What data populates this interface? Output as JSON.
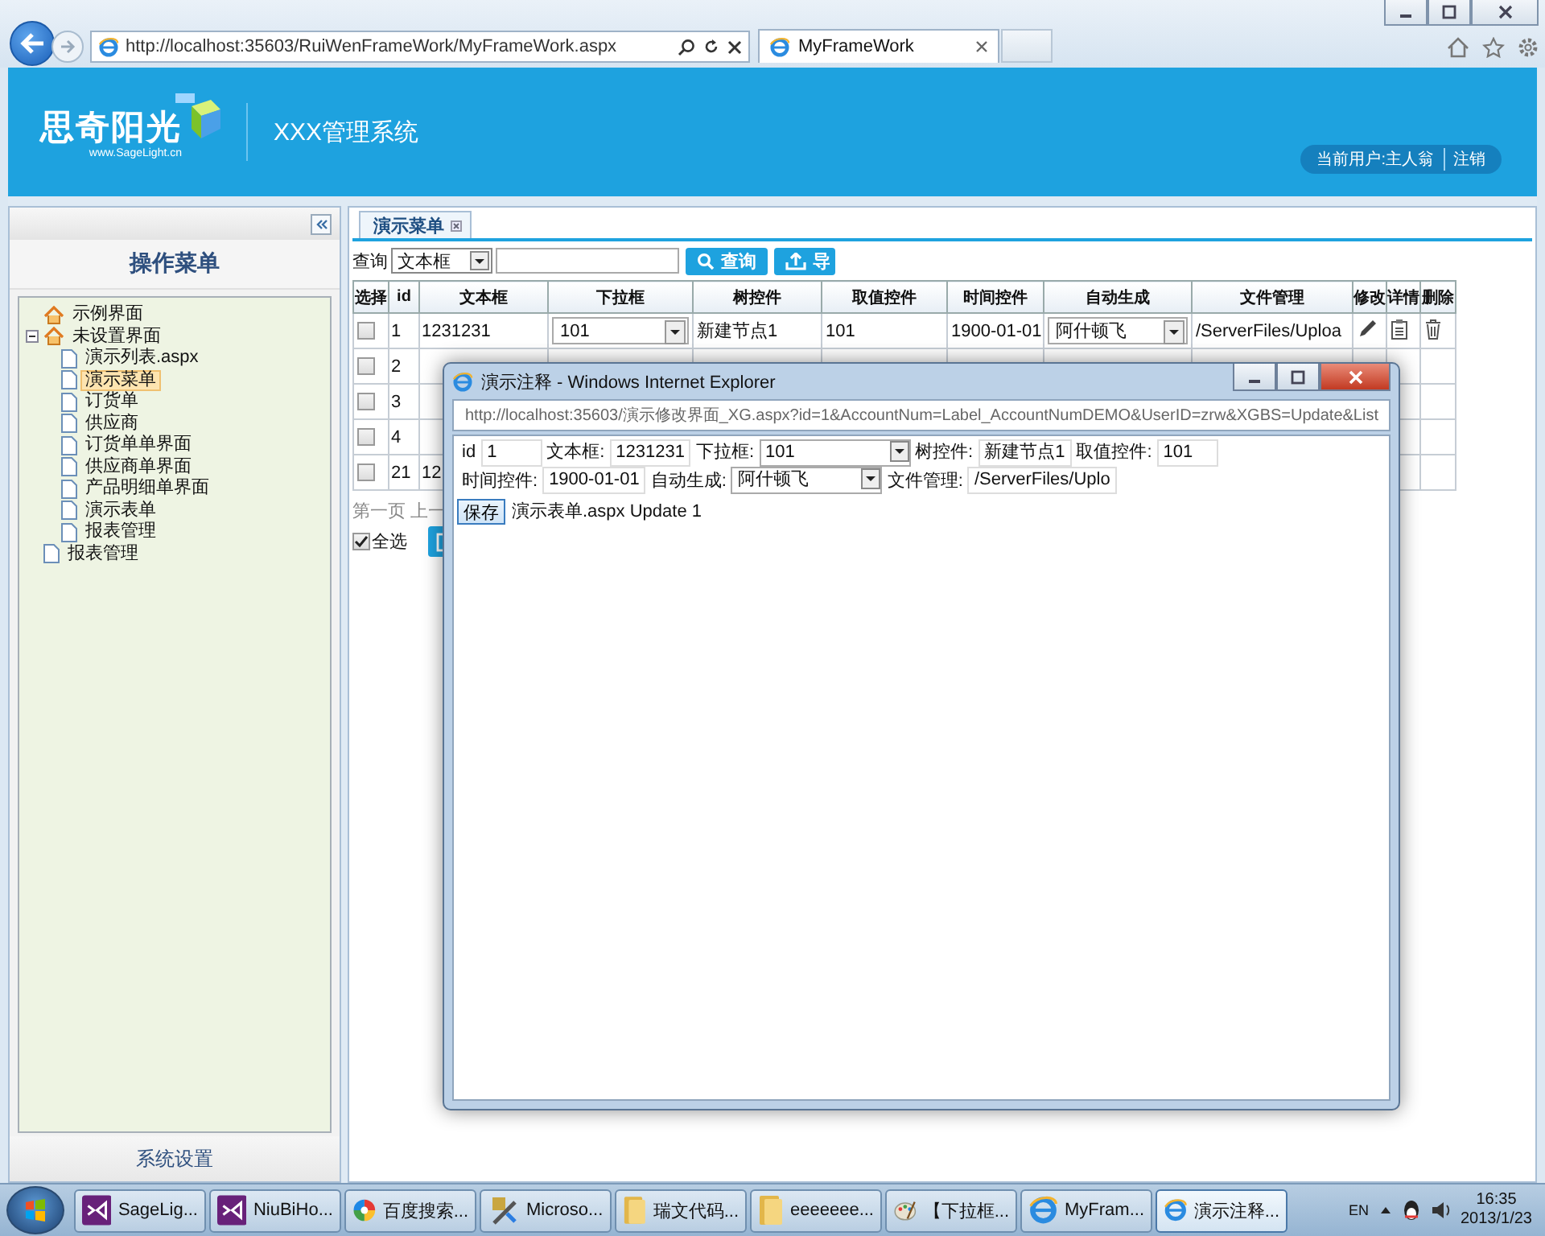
{
  "browser": {
    "address": "http://localhost:35603/RuiWenFrameWork/MyFrameWork.aspx",
    "tab": "MyFrameWork"
  },
  "header": {
    "logo": "思奇阳光",
    "logo_sub": "www.SageLight.cn",
    "system_title": "XXX管理系统",
    "user": "当前用户:主人翁",
    "logout": "注销"
  },
  "sidebar": {
    "title": "操作菜单",
    "footer": "系统设置",
    "tree": [
      {
        "label": "示例界面",
        "kind": "home",
        "selected": false
      },
      {
        "label": "未设置界面",
        "kind": "home",
        "selected": false,
        "expanded": true,
        "children": [
          {
            "label": "演示列表.aspx",
            "kind": "page",
            "selected": false
          },
          {
            "label": "演示菜单",
            "kind": "page",
            "selected": true
          },
          {
            "label": "订货单",
            "kind": "page",
            "selected": false
          },
          {
            "label": "供应商",
            "kind": "page",
            "selected": false
          },
          {
            "label": "订货单单界面",
            "kind": "page",
            "selected": false
          },
          {
            "label": "供应商单界面",
            "kind": "page",
            "selected": false
          },
          {
            "label": "产品明细单界面",
            "kind": "page",
            "selected": false
          },
          {
            "label": "演示表单",
            "kind": "page",
            "selected": false
          },
          {
            "label": "报表管理",
            "kind": "page",
            "selected": false
          }
        ]
      },
      {
        "label": "报表管理",
        "kind": "page",
        "selected": false
      }
    ]
  },
  "main": {
    "tab": "演示菜单",
    "query": {
      "label": "查询",
      "field": "文本框",
      "search_button": "查询",
      "export_button": "导"
    },
    "table": {
      "columns": [
        "选择",
        "id",
        "文本框",
        "下拉框",
        "树控件",
        "取值控件",
        "时间控件",
        "自动生成",
        "文件管理",
        "修改",
        "详情",
        "删除"
      ],
      "rows": [
        {
          "checked": false,
          "id": "1",
          "text": "1231231",
          "dropdown": "101",
          "tree": "新建节点1",
          "value": "101",
          "date": "1900-01-01",
          "auto": "阿什顿飞",
          "file": "/ServerFiles/Uploa"
        },
        {
          "checked": false,
          "id": "2"
        },
        {
          "checked": false,
          "id": "3"
        },
        {
          "checked": false,
          "id": "4"
        },
        {
          "checked": false,
          "id": "21",
          "text": "12"
        }
      ]
    },
    "pager": "第一页 上一",
    "select_all": {
      "label": "全选",
      "checked": true
    }
  },
  "popup": {
    "title": "演示注释 - Windows Internet Explorer",
    "address": "http://localhost:35603/演示修改界面_XG.aspx?id=1&AccountNum=Label_AccountNumDEMO&UserID=zrw&XGBS=Update&List",
    "fields": [
      {
        "label": "id",
        "value": "1",
        "kind": "input"
      },
      {
        "label": "文本框:",
        "value": "1231231",
        "kind": "input"
      },
      {
        "label": "下拉框:",
        "value": "101",
        "kind": "select"
      },
      {
        "label": "树控件:",
        "value": "新建节点1",
        "kind": "input"
      },
      {
        "label": "取值控件:",
        "value": "101",
        "kind": "input"
      },
      {
        "label": "时间控件:",
        "value": "1900-01-01",
        "kind": "input"
      },
      {
        "label": "自动生成:",
        "value": "阿什顿飞",
        "kind": "select"
      },
      {
        "label": "文件管理:",
        "value": "/ServerFiles/Uplo",
        "kind": "input"
      }
    ],
    "save_button": "保存",
    "message": "演示表单.aspx Update 1"
  },
  "taskbar": {
    "items": [
      {
        "label": "SageLig...",
        "kind": "vs",
        "selected": false
      },
      {
        "label": "NiuBiHo...",
        "kind": "vs",
        "selected": false
      },
      {
        "label": "百度搜索...",
        "kind": "wheel",
        "selected": false
      },
      {
        "label": "Microso...",
        "kind": "tool",
        "selected": false
      },
      {
        "label": "瑞文代码...",
        "kind": "folder",
        "selected": false
      },
      {
        "label": "eeeeeee...",
        "kind": "folder",
        "selected": false
      },
      {
        "label": "【下拉框...",
        "kind": "paint",
        "selected": false
      },
      {
        "label": "MyFram...",
        "kind": "ie",
        "selected": false
      },
      {
        "label": "演示注释...",
        "kind": "ie",
        "selected": true
      }
    ],
    "language": "EN",
    "time": "16:35",
    "date": "2013/1/23"
  }
}
